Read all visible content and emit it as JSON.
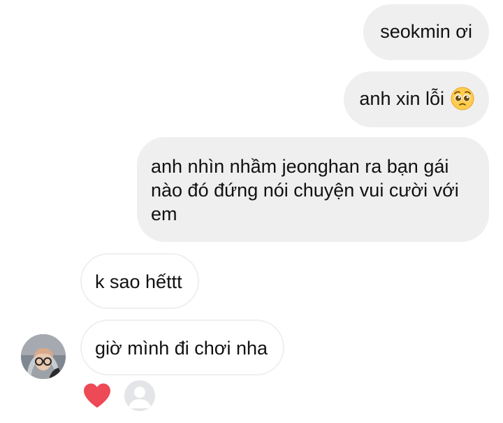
{
  "messages": {
    "sent": [
      {
        "text": "seokmin ơi"
      },
      {
        "text": "anh xin lỗi",
        "emoji": "pleading-face-icon"
      },
      {
        "text": "anh nhìn nhầm jeonghan ra bạn gái nào đó đứng nói chuyện vui cười với em"
      }
    ],
    "received": [
      {
        "text": "k sao hếttt"
      },
      {
        "text": "giờ mình đi chơi nha"
      }
    ]
  },
  "reaction": {
    "icon": "heart-icon",
    "color": "#ed4956"
  },
  "colors": {
    "sent_bubble": "#efefef",
    "received_border": "#efefef",
    "text": "#111111"
  }
}
